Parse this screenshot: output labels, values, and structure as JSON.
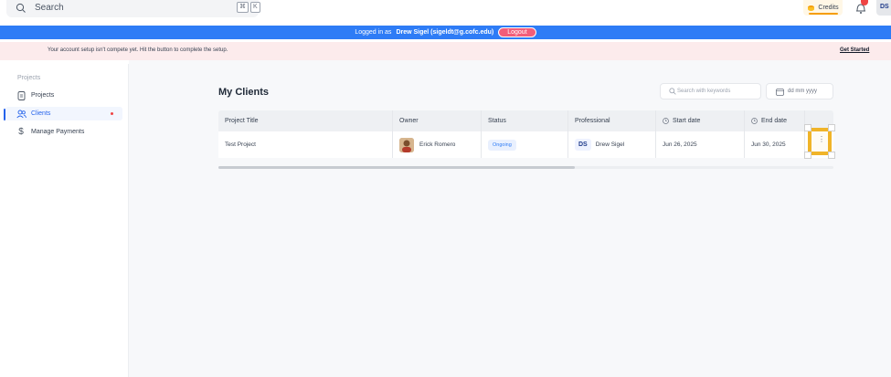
{
  "topbar": {
    "search_placeholder": "Search",
    "shortcut_keys": [
      "⌘",
      "K"
    ],
    "credits_label": "Credits",
    "user_initials": "DS"
  },
  "login_banner": {
    "prefix": "Logged in as",
    "user": "Drew Sigel (sigeldt@g.cofc.edu)",
    "logout_label": "Logout"
  },
  "setup_banner": {
    "message": "Your account setup isn't compete yet. Hit the button to complete the setup.",
    "cta": "Get Started"
  },
  "sidebar": {
    "section_title": "Projects",
    "items": [
      {
        "label": "Projects",
        "icon": "document-icon"
      },
      {
        "label": "Clients",
        "icon": "users-icon",
        "active": true,
        "has_dot": true
      },
      {
        "label": "Manage Payments",
        "icon": "dollar-icon"
      }
    ]
  },
  "main": {
    "title": "My Clients",
    "keyword_search_placeholder": "Search with keywords",
    "date_placeholder": "dd mm yyyy",
    "table": {
      "headers": [
        "Project Title",
        "Owner",
        "Status",
        "Professional",
        "Start date",
        "End date"
      ],
      "rows": [
        {
          "project_title": "Test Project",
          "owner": "Erick Romero",
          "status": "Ongoing",
          "professional_initials": "DS",
          "professional": "Drew Sigel",
          "start_date": "Jun 26, 2025",
          "end_date": "Jun 30, 2025"
        }
      ]
    }
  },
  "colors": {
    "accent_blue": "#2e7cf6",
    "logout_pink": "#f25d7a",
    "highlight_gold": "#f0b429",
    "setup_banner_bg": "#fcebec"
  }
}
